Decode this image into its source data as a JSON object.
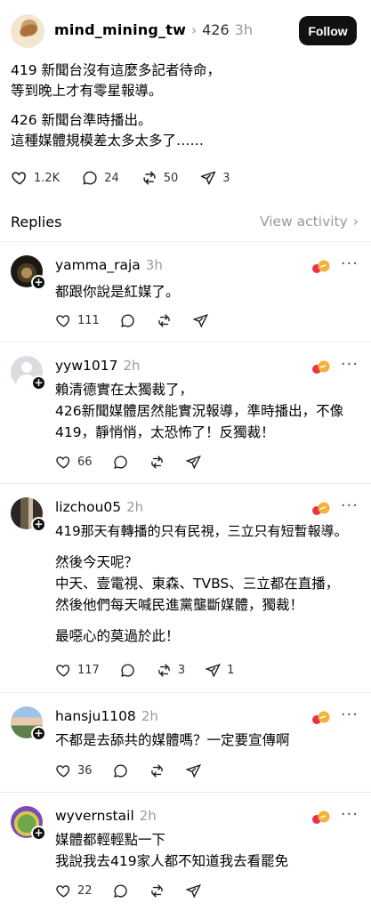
{
  "post": {
    "username": "mind_mining_tw",
    "number": "426",
    "time": "3h",
    "follow_label": "Follow",
    "paragraphs": [
      "419 新聞台沒有這麼多記者待命，",
      "等到晚上才有零星報導。",
      "426 新聞台準時播出。",
      "這種媒體規模差太多太多了……"
    ],
    "stats": {
      "likes": "1.2K",
      "comments": "24",
      "reposts": "50",
      "shares": "3"
    }
  },
  "replies_header": {
    "title": "Replies",
    "view_activity": "View activity"
  },
  "replies": [
    {
      "username": "yamma_raja",
      "time": "3h",
      "lines": [
        "都跟你說是紅媒了。"
      ],
      "likes": "111",
      "comments": "",
      "reposts": "",
      "shares": ""
    },
    {
      "username": "yyw1017",
      "time": "2h",
      "lines": [
        "賴清德實在太獨裁了，",
        "426新聞媒體居然能實況報導，準時播出，不像",
        "419，靜悄悄，太恐怖了！反獨裁！"
      ],
      "likes": "66",
      "comments": "",
      "reposts": "",
      "shares": ""
    },
    {
      "username": "lizchou05",
      "time": "2h",
      "lines": [
        "419那天有轉播的只有民視，三立只有短暫報導。",
        "然後今天呢？",
        "中天、壹電視、東森、TVBS、三立都在直播，",
        "然後他們每天喊民進黨壟斷媒體，獨裁！",
        "最噁心的莫過於此！"
      ],
      "likes": "117",
      "comments": "",
      "reposts": "3",
      "shares": "1"
    },
    {
      "username": "hansju1108",
      "time": "2h",
      "lines": [
        "不都是去舔共的媒體嗎？一定要宣傳啊"
      ],
      "likes": "36",
      "comments": "",
      "reposts": "",
      "shares": ""
    },
    {
      "username": "wyvernstail",
      "time": "2h",
      "lines": [
        "媒體都輕輕點一下",
        "我說我去419家人都不知道我去看罷免"
      ],
      "likes": "22",
      "comments": "",
      "reposts": "",
      "shares": ""
    }
  ]
}
